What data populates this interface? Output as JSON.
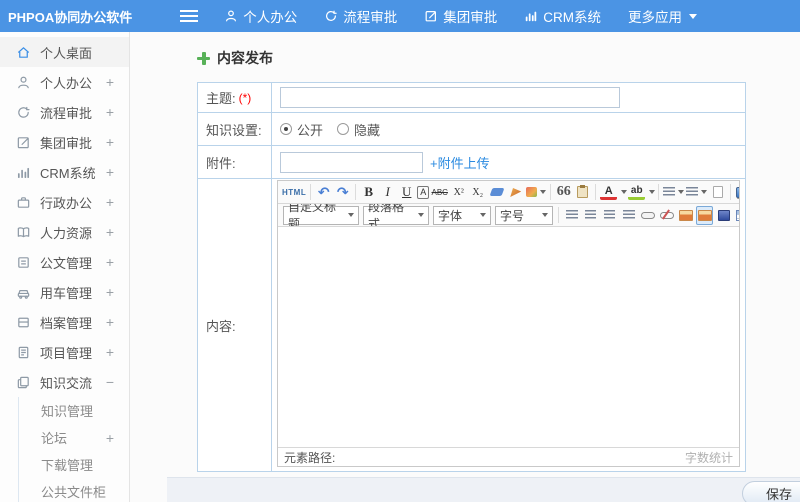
{
  "navbar": {
    "logo": "PHPOA协同办公软件",
    "items": [
      {
        "label": "个人办公",
        "icon": "user-icon"
      },
      {
        "label": "流程审批",
        "icon": "process-icon"
      },
      {
        "label": "集团审批",
        "icon": "edit-square-icon"
      },
      {
        "label": "CRM系统",
        "icon": "bar-chart-icon"
      },
      {
        "label": "更多应用",
        "icon": "chevron-down-icon"
      }
    ]
  },
  "sidebar": {
    "items": [
      {
        "label": "个人桌面",
        "icon": "home-icon",
        "expand": "",
        "active": true
      },
      {
        "label": "个人办公",
        "icon": "user-icon",
        "expand": "+"
      },
      {
        "label": "流程审批",
        "icon": "process-icon",
        "expand": "+"
      },
      {
        "label": "集团审批",
        "icon": "edit-square-icon",
        "expand": "+"
      },
      {
        "label": "CRM系统",
        "icon": "bar-chart-icon",
        "expand": "+"
      },
      {
        "label": "行政办公",
        "icon": "briefcase-icon",
        "expand": "+"
      },
      {
        "label": "人力资源",
        "icon": "book-icon",
        "expand": "+"
      },
      {
        "label": "公文管理",
        "icon": "document-icon",
        "expand": "+"
      },
      {
        "label": "用车管理",
        "icon": "car-icon",
        "expand": "+"
      },
      {
        "label": "档案管理",
        "icon": "archive-icon",
        "expand": "+"
      },
      {
        "label": "项目管理",
        "icon": "clipboard-icon",
        "expand": "+"
      },
      {
        "label": "知识交流",
        "icon": "copy-pages-icon",
        "expand": "−"
      }
    ],
    "subitems": [
      {
        "label": "知识管理",
        "expand": ""
      },
      {
        "label": "论坛",
        "expand": "+"
      },
      {
        "label": "下载管理",
        "expand": ""
      },
      {
        "label": "公共文件柜",
        "expand": ""
      }
    ]
  },
  "page": {
    "title": "内容发布"
  },
  "form": {
    "subject_label": "主题:",
    "required_mark": "(*)",
    "subject_value": "",
    "knowledge_label": "知识设置:",
    "radio_public": "公开",
    "radio_hidden": "隐藏",
    "attachment_label": "附件:",
    "attachment_value": "",
    "upload_link": "+附件上传",
    "content_label": "内容:"
  },
  "editor": {
    "tb1": [
      {
        "name": "html-source-button",
        "glyph": "HTML"
      },
      {
        "name": "undo-icon",
        "glyph": "↶"
      },
      {
        "name": "redo-icon",
        "glyph": "↷"
      },
      {
        "name": "bold-button",
        "glyph": "B"
      },
      {
        "name": "italic-button",
        "glyph": "I"
      },
      {
        "name": "underline-button",
        "glyph": "U"
      },
      {
        "name": "autotypeset-button",
        "glyph": "A"
      },
      {
        "name": "strikethrough-button",
        "glyph": "ABC"
      },
      {
        "name": "superscript-button",
        "glyph": "X²"
      },
      {
        "name": "subscript-button",
        "glyph": "X₂"
      },
      {
        "name": "blockquote-button",
        "glyph": "66"
      },
      {
        "name": "font-color-button",
        "glyph": "A"
      },
      {
        "name": "bg-color-button",
        "glyph": "ab"
      }
    ],
    "css_icons": [
      "eraser-icon",
      "brush-icon",
      "format-painter-icon",
      "paste-icon",
      "unordered-list-icon",
      "ordered-list-icon",
      "new-doc-icon",
      "fullscreen-icon",
      "align-left-icon",
      "align-center-icon",
      "align-right-icon",
      "align-justify-icon",
      "link-icon",
      "unlink-icon",
      "image-icon",
      "image-upload-icon",
      "video-icon",
      "table-icon"
    ],
    "selects": [
      {
        "label": "自定义标题"
      },
      {
        "label": "段落格式"
      },
      {
        "label": "字体"
      },
      {
        "label": "字号"
      }
    ],
    "status_left": "元素路径:",
    "status_right": "字数统计"
  },
  "footer": {
    "save_label": "保存"
  },
  "colors": {
    "navbar_blue": "#4b94e4",
    "link_blue": "#2a8ae0",
    "required_red": "#ff0000",
    "table_border_blue": "#b9d3ea",
    "green_plus": "#58b158",
    "active_icon_blue": "#3a8ee6"
  }
}
